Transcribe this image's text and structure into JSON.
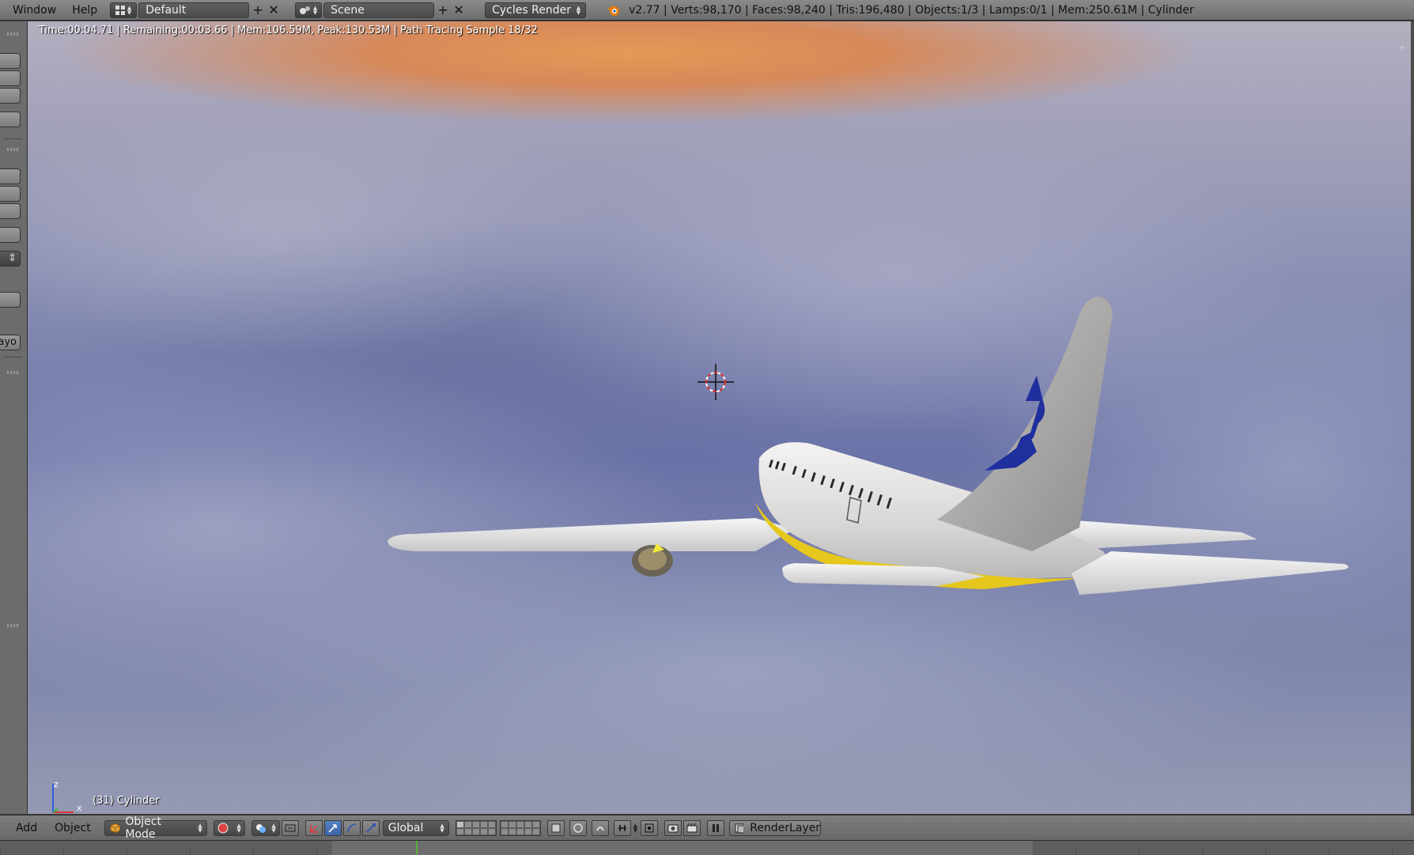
{
  "topbar": {
    "menus": [
      "Window",
      "Help"
    ],
    "screen_layout": "Default",
    "scene": "Scene",
    "render_engine": "Cycles Render",
    "stats": "v2.77 | Verts:98,170 | Faces:98,240 | Tris:196,480 | Objects:1/3 | Lamps:0/1 | Mem:250.61M | Cylinder"
  },
  "viewport": {
    "render_info": "Time:00:04.71 | Remaining:00:03.66 | Mem:106.59M, Peak:130.53M | Path Tracing Sample 18/32",
    "object_label": "(31) Cylinder",
    "axis_z": "z",
    "axis_x": "x",
    "colors": {
      "sky_glow": "#e39a55",
      "clouds": "#7f86ab",
      "fuselage": "#e8e6e4",
      "belly_stripe": "#e6c71c",
      "tail_logo": "#1f2f9e"
    }
  },
  "left_toolbar": {
    "truncated_label": "ayo"
  },
  "bottombar": {
    "menus": [
      "Add",
      "Object"
    ],
    "mode": "Object Mode",
    "orientation": "Global",
    "render_layer": "RenderLayer"
  },
  "icons": [
    "editor-type-icon",
    "scene-icon",
    "blender-logo-icon",
    "add-icon",
    "close-icon",
    "object-mode-cube-icon",
    "viewport-shading-icon",
    "pivot-icon",
    "manipulator-icon",
    "translate-icon",
    "rotate-icon",
    "scale-icon",
    "layers-icon",
    "snap-icon",
    "render-icon",
    "camera-icon"
  ]
}
